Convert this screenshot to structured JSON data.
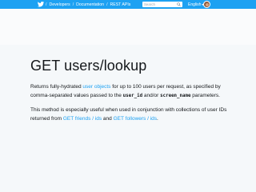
{
  "topbar": {
    "logo_icon": "twitter-bird-icon",
    "breadcrumbs": [
      "Developers",
      "Documentation",
      "REST APIs"
    ],
    "separator": "/",
    "search": {
      "placeholder": "Search",
      "icon": "search-icon"
    },
    "language": {
      "label": "English",
      "icon": "chevron-down-icon"
    },
    "avatar_icon": "user-avatar"
  },
  "page": {
    "title": "GET users/lookup",
    "paragraph1": {
      "t1": "Returns fully-hydrated ",
      "link1": "user objects",
      "t2": " for up to 100 users per request, as specified by comma-separated values passed to the ",
      "code1": "user_id",
      "t3": " and/or ",
      "code2": "screen_name",
      "t4": " parameters."
    },
    "paragraph2": {
      "t1": "This method is especially useful when used in conjunction with collections of user IDs returned from ",
      "link1": "GET friends / ids",
      "t2": " and ",
      "link2": "GET followers / ids",
      "t3": "."
    }
  },
  "colors": {
    "brand": "#1da1f2",
    "text": "#14171a",
    "background": "#f5f8fa"
  }
}
